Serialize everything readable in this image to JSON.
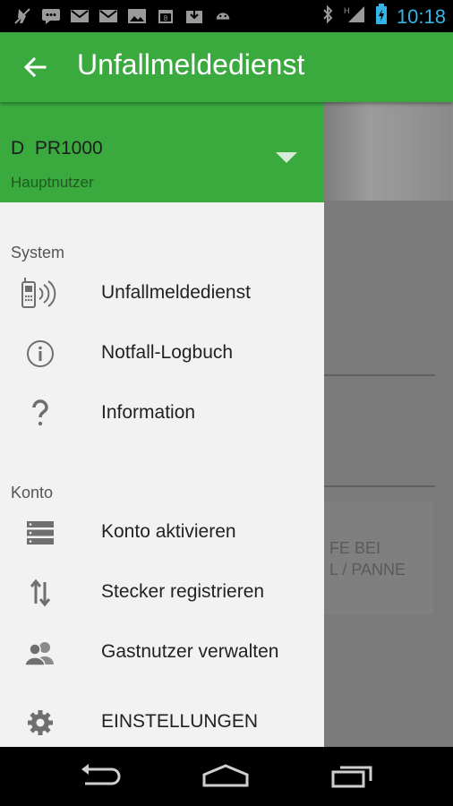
{
  "status_bar": {
    "time": "10:18",
    "network_type": "H",
    "left_icons": [
      "mute-icon",
      "chat-icon",
      "gmail-icon",
      "gmail-icon",
      "image-icon",
      "calendar-icon",
      "download-icon",
      "android-icon"
    ],
    "right_icons": [
      "bluetooth-icon",
      "signal-icon",
      "battery-charging-icon"
    ]
  },
  "app_bar": {
    "title": "Unfallmeldedienst",
    "back_icon": "back-arrow-icon",
    "color": "#3aaa3f"
  },
  "drawer": {
    "account": {
      "name": "D  PR1000",
      "role": "Hauptnutzer",
      "dropdown_icon": "caret-down-icon"
    },
    "sections": [
      {
        "title": "System",
        "items": [
          {
            "label": "Unfallmeldedienst",
            "icon": "phone-signal-icon"
          },
          {
            "label": "Notfall-Logbuch",
            "icon": "info-circle-icon"
          },
          {
            "label": "Information",
            "icon": "question-icon"
          }
        ]
      },
      {
        "title": "Konto",
        "items": [
          {
            "label": "Konto aktivieren",
            "icon": "server-icon"
          },
          {
            "label": "Stecker registrieren",
            "icon": "up-down-arrows-icon"
          },
          {
            "label": "Gastnutzer verwalten",
            "icon": "people-icon"
          }
        ]
      }
    ],
    "settings": {
      "label": "EINSTELLUNGEN",
      "icon": "gear-icon"
    }
  },
  "background_content": {
    "card_text_line1": "FE BEI",
    "card_text_line2": "L / PANNE"
  },
  "nav_bar": {
    "icons": [
      "back-nav-icon",
      "home-nav-icon",
      "recents-nav-icon"
    ]
  }
}
